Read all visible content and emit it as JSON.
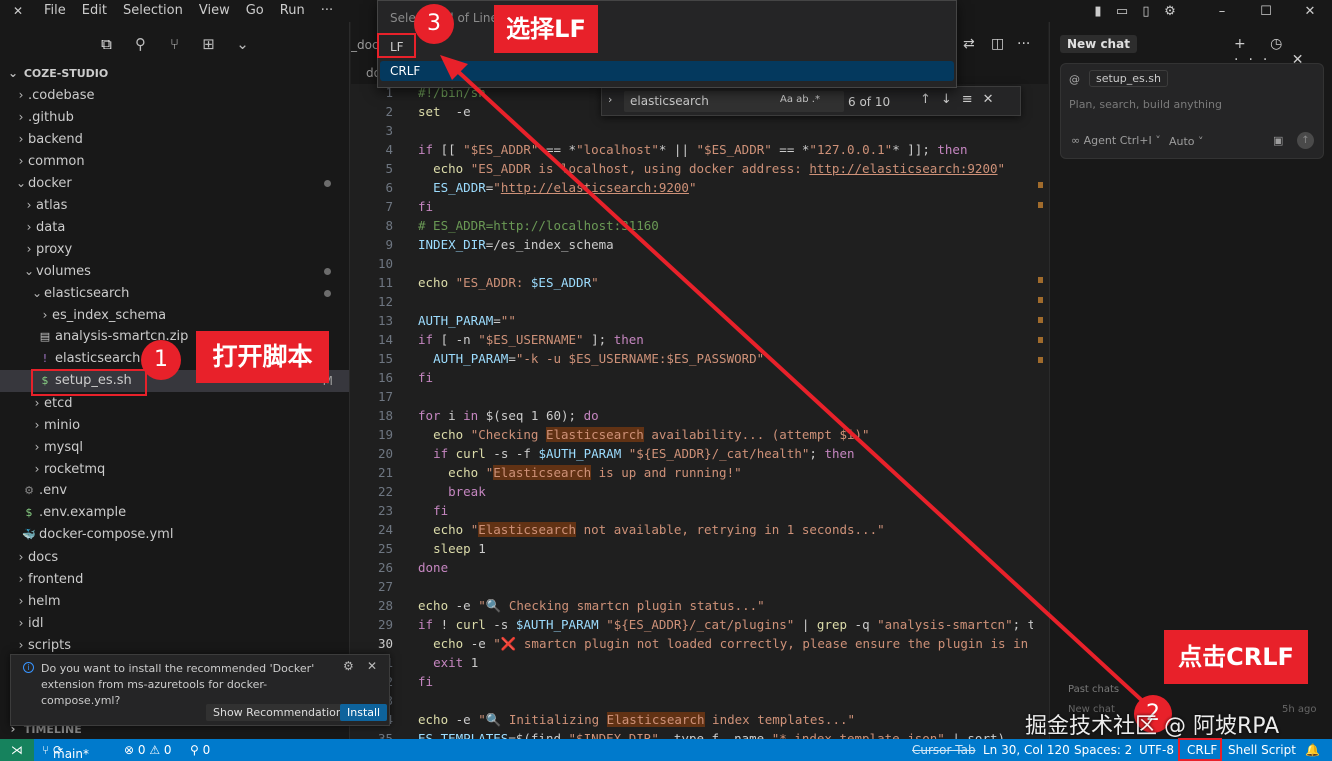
{
  "menu": [
    "File",
    "Edit",
    "Selection",
    "View",
    "Go",
    "Run",
    "···"
  ],
  "window_buttons": [
    "–",
    "☐",
    "✕"
  ],
  "explorer": {
    "root": "COZE-STUDIO",
    "items": [
      {
        "label": ".codebase",
        "depth": 1,
        "kind": "folder-closed"
      },
      {
        "label": ".github",
        "depth": 1,
        "kind": "folder-closed"
      },
      {
        "label": "backend",
        "depth": 1,
        "kind": "folder-closed"
      },
      {
        "label": "common",
        "depth": 1,
        "kind": "folder-closed"
      },
      {
        "label": "docker",
        "depth": 1,
        "kind": "folder-open",
        "dot": true
      },
      {
        "label": "atlas",
        "depth": 2,
        "kind": "folder-closed"
      },
      {
        "label": "data",
        "depth": 2,
        "kind": "folder-closed"
      },
      {
        "label": "proxy",
        "depth": 2,
        "kind": "folder-closed"
      },
      {
        "label": "volumes",
        "depth": 2,
        "kind": "folder-open",
        "dot": true
      },
      {
        "label": "elasticsearch",
        "depth": 3,
        "kind": "folder-open",
        "dot": true
      },
      {
        "label": "es_index_schema",
        "depth": 4,
        "kind": "folder-closed"
      },
      {
        "label": "analysis-smartcn.zip",
        "depth": 4,
        "kind": "zip"
      },
      {
        "label": "elasticsearch.y",
        "depth": 4,
        "kind": "yaml"
      },
      {
        "label": "setup_es.sh",
        "depth": 4,
        "kind": "shell",
        "selected": true,
        "mod": "M"
      },
      {
        "label": "etcd",
        "depth": 3,
        "kind": "folder-closed"
      },
      {
        "label": "minio",
        "depth": 3,
        "kind": "folder-closed"
      },
      {
        "label": "mysql",
        "depth": 3,
        "kind": "folder-closed"
      },
      {
        "label": "rocketmq",
        "depth": 3,
        "kind": "folder-closed"
      },
      {
        "label": ".env",
        "depth": 2,
        "kind": "gear"
      },
      {
        "label": ".env.example",
        "depth": 2,
        "kind": "shell"
      },
      {
        "label": "docker-compose.yml",
        "depth": 2,
        "kind": "docker"
      },
      {
        "label": "docs",
        "depth": 1,
        "kind": "folder-closed"
      },
      {
        "label": "frontend",
        "depth": 1,
        "kind": "folder-closed"
      },
      {
        "label": "helm",
        "depth": 1,
        "kind": "folder-closed"
      },
      {
        "label": "idl",
        "depth": 1,
        "kind": "folder-closed"
      },
      {
        "label": "scripts",
        "depth": 1,
        "kind": "folder-closed"
      }
    ],
    "timeline": "TIMELINE"
  },
  "notification": {
    "message": "Do you want to install the recommended 'Docker' extension from ms-azuretools for docker-compose.yml?",
    "show_recommendations": "Show Recommendations",
    "install": "Install"
  },
  "tab_fragments": [
    "_doc",
    "doc"
  ],
  "quick_pick": {
    "placeholder": "Select End of Line Sequence",
    "options": [
      "LF",
      "CRLF"
    ]
  },
  "find": {
    "query": "elasticsearch",
    "options": "Aa  ab  .*",
    "count": "6 of 10"
  },
  "code_lines": [
    {
      "n": "1",
      "t": [
        [
          "c",
          "#!/bin/sh"
        ]
      ]
    },
    {
      "n": "2",
      "t": [
        [
          "b",
          "set"
        ],
        [
          "",
          "  -e"
        ]
      ]
    },
    {
      "n": "3",
      "t": []
    },
    {
      "n": "4",
      "t": [
        [
          "k",
          "if"
        ],
        [
          "",
          " [[ "
        ],
        [
          "s",
          "\"$ES_ADDR\""
        ],
        [
          "",
          " == *"
        ],
        [
          "s",
          "\"localhost\""
        ],
        [
          "",
          "* || "
        ],
        [
          "s",
          "\"$ES_ADDR\""
        ],
        [
          "",
          " == *"
        ],
        [
          "s",
          "\"127.0.0.1\""
        ],
        [
          "",
          "* ]]; "
        ],
        [
          "k",
          "then"
        ]
      ]
    },
    {
      "n": "5",
      "t": [
        [
          "",
          "  "
        ],
        [
          "b",
          "echo"
        ],
        [
          "s",
          " \"ES_ADDR is localhost, using docker address: "
        ],
        [
          "u",
          "http://elasticsearch:9200"
        ],
        [
          "s",
          "\""
        ]
      ]
    },
    {
      "n": "6",
      "t": [
        [
          "",
          "  "
        ],
        [
          "v",
          "ES_ADDR"
        ],
        [
          "",
          "="
        ],
        [
          "s",
          "\""
        ],
        [
          "u",
          "http://elasticsearch:9200"
        ],
        [
          "s",
          "\""
        ]
      ]
    },
    {
      "n": "7",
      "t": [
        [
          "k",
          "fi"
        ]
      ]
    },
    {
      "n": "8",
      "t": [
        [
          "c",
          "# ES_ADDR=http://localhost:31160"
        ]
      ]
    },
    {
      "n": "9",
      "t": [
        [
          "v",
          "INDEX_DIR"
        ],
        [
          "",
          "=/es_index_schema"
        ]
      ]
    },
    {
      "n": "10",
      "t": []
    },
    {
      "n": "11",
      "t": [
        [
          "b",
          "echo"
        ],
        [
          "s",
          " \"ES_ADDR: "
        ],
        [
          "v",
          "$ES_ADDR"
        ],
        [
          "s",
          "\""
        ]
      ]
    },
    {
      "n": "12",
      "t": []
    },
    {
      "n": "13",
      "t": [
        [
          "v",
          "AUTH_PARAM"
        ],
        [
          "",
          "="
        ],
        [
          "s",
          "\"\""
        ]
      ]
    },
    {
      "n": "14",
      "t": [
        [
          "k",
          "if"
        ],
        [
          "",
          " [ -n "
        ],
        [
          "s",
          "\"$ES_USERNAME\""
        ],
        [
          "",
          " ]; "
        ],
        [
          "k",
          "then"
        ]
      ]
    },
    {
      "n": "15",
      "t": [
        [
          "",
          "  "
        ],
        [
          "v",
          "AUTH_PARAM"
        ],
        [
          "",
          "="
        ],
        [
          "s",
          "\"-k -u $ES_USERNAME:$ES_PASSWORD\""
        ]
      ]
    },
    {
      "n": "16",
      "t": [
        [
          "k",
          "fi"
        ]
      ]
    },
    {
      "n": "17",
      "t": []
    },
    {
      "n": "18",
      "t": [
        [
          "k",
          "for"
        ],
        [
          "",
          " i "
        ],
        [
          "k",
          "in"
        ],
        [
          "",
          " $(seq 1 60); "
        ],
        [
          "k",
          "do"
        ]
      ]
    },
    {
      "n": "19",
      "t": [
        [
          "",
          "  "
        ],
        [
          "b",
          "echo"
        ],
        [
          "s",
          " \"Checking "
        ],
        [
          "hl",
          "Elasticsearch"
        ],
        [
          "s",
          " availability... (attempt $i)\""
        ]
      ]
    },
    {
      "n": "20",
      "t": [
        [
          "",
          "  "
        ],
        [
          "k",
          "if"
        ],
        [
          "",
          " "
        ],
        [
          "b",
          "curl"
        ],
        [
          "",
          " -s -f "
        ],
        [
          "v",
          "$AUTH_PARAM"
        ],
        [
          "",
          " "
        ],
        [
          "s",
          "\"${ES_ADDR}/_cat/health\""
        ],
        [
          "",
          "; "
        ],
        [
          "k",
          "then"
        ]
      ]
    },
    {
      "n": "21",
      "t": [
        [
          "",
          "    "
        ],
        [
          "b",
          "echo"
        ],
        [
          "s",
          " \""
        ],
        [
          "hl",
          "Elasticsearch"
        ],
        [
          "s",
          " is up and running!\""
        ]
      ]
    },
    {
      "n": "22",
      "t": [
        [
          "",
          "    "
        ],
        [
          "k",
          "break"
        ]
      ]
    },
    {
      "n": "23",
      "t": [
        [
          "",
          "  "
        ],
        [
          "k",
          "fi"
        ]
      ]
    },
    {
      "n": "24",
      "t": [
        [
          "",
          "  "
        ],
        [
          "b",
          "echo"
        ],
        [
          "s",
          " \""
        ],
        [
          "hl",
          "Elasticsearch"
        ],
        [
          "s",
          " not available, retrying in 1 seconds...\""
        ]
      ]
    },
    {
      "n": "25",
      "t": [
        [
          "",
          "  "
        ],
        [
          "b",
          "sleep"
        ],
        [
          "",
          " 1"
        ]
      ]
    },
    {
      "n": "26",
      "t": [
        [
          "k",
          "done"
        ]
      ]
    },
    {
      "n": "27",
      "t": []
    },
    {
      "n": "28",
      "t": [
        [
          "b",
          "echo"
        ],
        [
          "",
          " -e "
        ],
        [
          "s",
          "\"🔍 Checking smartcn plugin status...\""
        ]
      ]
    },
    {
      "n": "29",
      "t": [
        [
          "k",
          "if"
        ],
        [
          "",
          " ! "
        ],
        [
          "b",
          "curl"
        ],
        [
          "",
          " -s "
        ],
        [
          "v",
          "$AUTH_PARAM"
        ],
        [
          "",
          " "
        ],
        [
          "s",
          "\"${ES_ADDR}/_cat/plugins\""
        ],
        [
          "",
          " | "
        ],
        [
          "b",
          "grep"
        ],
        [
          "",
          " -q "
        ],
        [
          "s",
          "\"analysis-smartcn\""
        ],
        [
          "",
          "; t"
        ]
      ]
    },
    {
      "n": "30",
      "t": [
        [
          "",
          "  "
        ],
        [
          "b",
          "echo"
        ],
        [
          "",
          " -e "
        ],
        [
          "s",
          "\"❌ smartcn plugin not loaded correctly, please ensure the plugin is in"
        ]
      ]
    },
    {
      "n": "31",
      "t": [
        [
          "",
          "  "
        ],
        [
          "k",
          "exit"
        ],
        [
          "",
          " 1"
        ]
      ]
    },
    {
      "n": "32",
      "t": [
        [
          "k",
          "fi"
        ]
      ]
    },
    {
      "n": "33",
      "t": []
    },
    {
      "n": "34",
      "t": [
        [
          "b",
          "echo"
        ],
        [
          "",
          " -e "
        ],
        [
          "s",
          "\"🔍 Initializing "
        ],
        [
          "hl",
          "Elasticsearch"
        ],
        [
          "s",
          " index templates...\""
        ]
      ]
    },
    {
      "n": "35",
      "t": [
        [
          "v",
          "ES_TEMPLATES"
        ],
        [
          "",
          "=$(find "
        ],
        [
          "s",
          "\"$INDEX_DIR\""
        ],
        [
          "",
          " -type f -name "
        ],
        [
          "s",
          "\"*.index-template.json\""
        ],
        [
          "",
          " | sort)"
        ]
      ]
    }
  ],
  "chat": {
    "header": "New chat",
    "header_buttons": "+ ◷ ··· ✕",
    "at": "@",
    "context_file": "setup_es.sh",
    "placeholder": "Plan, search, build anything",
    "agent": "∞ Agent Ctrl+I ˅",
    "auto": "Auto ˅",
    "past_chats": "Past chats",
    "new_chat_item": "New chat",
    "ago": "5h ago"
  },
  "status": {
    "branch": "main*",
    "errors": "⊗ 0 ⚠ 0",
    "ports": "⚲ 0",
    "cursor_tab": "Cursor Tab",
    "position": "Ln 30, Col 120",
    "spaces": "Spaces: 2",
    "encoding": "UTF-8",
    "eol": "CRLF",
    "language": "Shell Script"
  },
  "annotations": {
    "step1_num": "1",
    "step1_label": "打开脚本",
    "step2_num": "2",
    "step2_label": "点击CRLF",
    "step3_num": "3",
    "step3_label": "选择LF",
    "watermark": "掘金技术社区 @ 阿坡RPA",
    "color": "#e8212a"
  }
}
